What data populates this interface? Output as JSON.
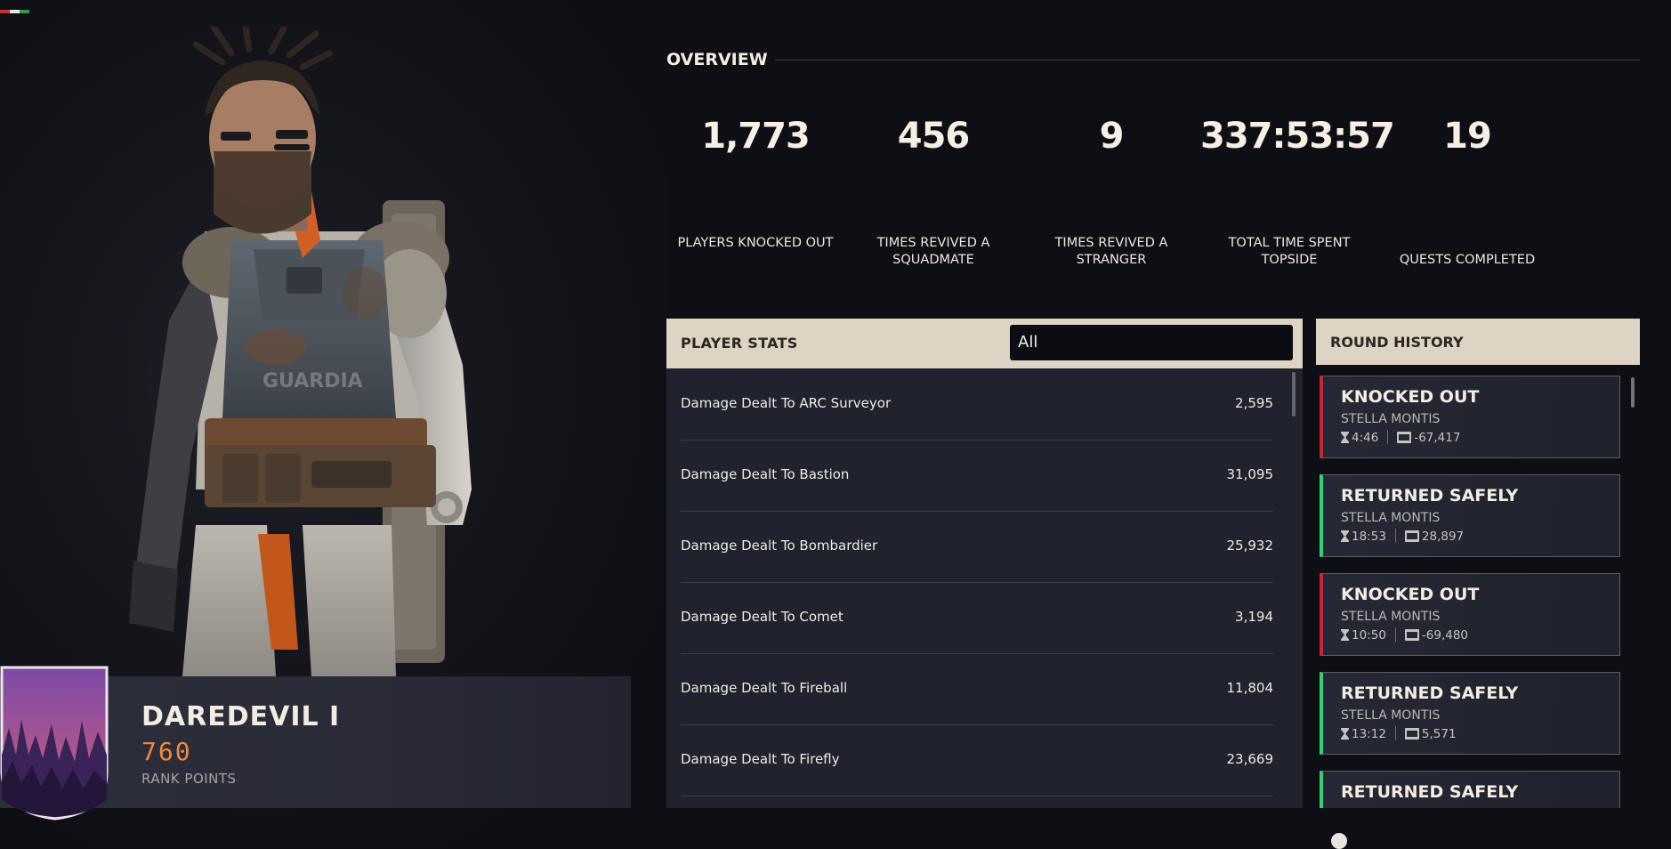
{
  "colors": {
    "accent_orange": "#f08a3c",
    "panel_header": "#ded4c4",
    "knocked_out": "#c8253a",
    "returned_safely": "#33d27a"
  },
  "character": {
    "icon": "character-portrait",
    "vest_text": "GUARDIA"
  },
  "rank": {
    "title": "DAREDEVIL I",
    "points": "760",
    "points_label": "RANK POINTS",
    "emblem_icon": "forest-shield-icon"
  },
  "overview": {
    "title": "OVERVIEW",
    "stats": [
      {
        "value": "1,773",
        "label": "PLAYERS KNOCKED OUT"
      },
      {
        "value": "456",
        "label": "TIMES REVIVED A SQUADMATE"
      },
      {
        "value": "9",
        "label": "TIMES REVIVED A STRANGER"
      },
      {
        "value": "337:53:57",
        "label": "TOTAL TIME SPENT TOPSIDE"
      },
      {
        "value": "19",
        "label": "QUESTS COMPLETED"
      }
    ]
  },
  "player_stats": {
    "title": "PLAYER STATS",
    "filter_value": "All",
    "rows": [
      {
        "name": "Damage Dealt To ARC Surveyor",
        "value": "2,595"
      },
      {
        "name": "Damage Dealt To Bastion",
        "value": "31,095"
      },
      {
        "name": "Damage Dealt To Bombardier",
        "value": "25,932"
      },
      {
        "name": "Damage Dealt To Comet",
        "value": "3,194"
      },
      {
        "name": "Damage Dealt To Fireball",
        "value": "11,804"
      },
      {
        "name": "Damage Dealt To Firefly",
        "value": "23,669"
      }
    ]
  },
  "round_history": {
    "title": "ROUND HISTORY",
    "rounds": [
      {
        "outcome": "KNOCKED OUT",
        "map": "STELLA MONTIS",
        "time": "4:46",
        "value": "-67,417"
      },
      {
        "outcome": "RETURNED SAFELY",
        "map": "STELLA MONTIS",
        "time": "18:53",
        "value": "28,897"
      },
      {
        "outcome": "KNOCKED OUT",
        "map": "STELLA MONTIS",
        "time": "10:50",
        "value": "-69,480"
      },
      {
        "outcome": "RETURNED SAFELY",
        "map": "STELLA MONTIS",
        "time": "13:12",
        "value": "5,571"
      },
      {
        "outcome": "RETURNED SAFELY",
        "map": "",
        "time": "",
        "value": ""
      }
    ]
  }
}
